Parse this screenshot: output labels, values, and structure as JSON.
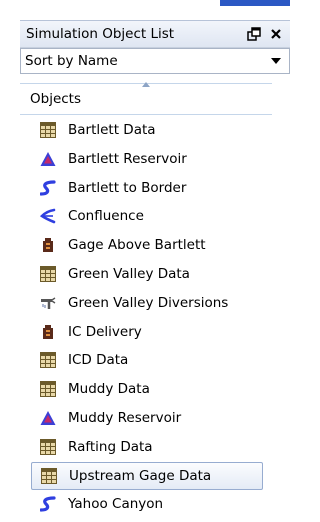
{
  "panel": {
    "title": "Simulation Object List",
    "pin_icon": "pin-icon",
    "close_icon": "close-icon"
  },
  "sort": {
    "value": "Sort by Name"
  },
  "list_header": {
    "label": "Objects"
  },
  "objects": [
    {
      "label": "Bartlett Data",
      "icon": "data-grid-icon"
    },
    {
      "label": "Bartlett Reservoir",
      "icon": "reservoir-triangle-icon"
    },
    {
      "label": "Bartlett to Border",
      "icon": "reach-icon"
    },
    {
      "label": "Confluence",
      "icon": "confluence-icon"
    },
    {
      "label": "Gage Above Bartlett",
      "icon": "gage-icon"
    },
    {
      "label": "Green Valley Data",
      "icon": "data-grid-icon"
    },
    {
      "label": "Green Valley Diversions",
      "icon": "diversion-icon"
    },
    {
      "label": "IC Delivery",
      "icon": "gage-icon"
    },
    {
      "label": "ICD Data",
      "icon": "data-grid-icon"
    },
    {
      "label": "Muddy Data",
      "icon": "data-grid-icon"
    },
    {
      "label": "Muddy Reservoir",
      "icon": "reservoir-triangle-icon"
    },
    {
      "label": "Rafting Data",
      "icon": "data-grid-icon"
    },
    {
      "label": "Upstream Gage Data",
      "icon": "data-grid-icon",
      "selected": true
    },
    {
      "label": "Yahoo Canyon",
      "icon": "reach-icon"
    }
  ],
  "colors": {
    "accent": "#2b58c4",
    "selection_border": "#97acd0",
    "title_bg": "#dfe6f2"
  }
}
